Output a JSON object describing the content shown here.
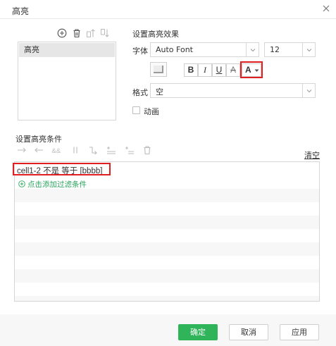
{
  "dialog": {
    "title": "高亮"
  },
  "highlight_list": {
    "items": [
      "高亮"
    ]
  },
  "effect": {
    "section_title": "设置高亮效果",
    "font_label": "字体",
    "font_value": "Auto Font",
    "size_value": "12",
    "bold_label": "B",
    "italic_label": "I",
    "underline_label": "U",
    "strike_label": "A",
    "font_color_label": "A",
    "format_label": "格式",
    "format_value": "空",
    "animation_label": "动画",
    "animation_checked": false
  },
  "conditions": {
    "section_title": "设置高亮条件",
    "clear_label": "清空",
    "rows": [
      "cell1-2 不是 等于 [bbbb]"
    ],
    "add_label": "点击添加过滤条件"
  },
  "footer": {
    "ok_label": "确定",
    "cancel_label": "取消",
    "apply_label": "应用"
  },
  "colors": {
    "accent": "#2fb45a",
    "highlight_border": "#e02020",
    "add_link": "#2aa35c"
  }
}
